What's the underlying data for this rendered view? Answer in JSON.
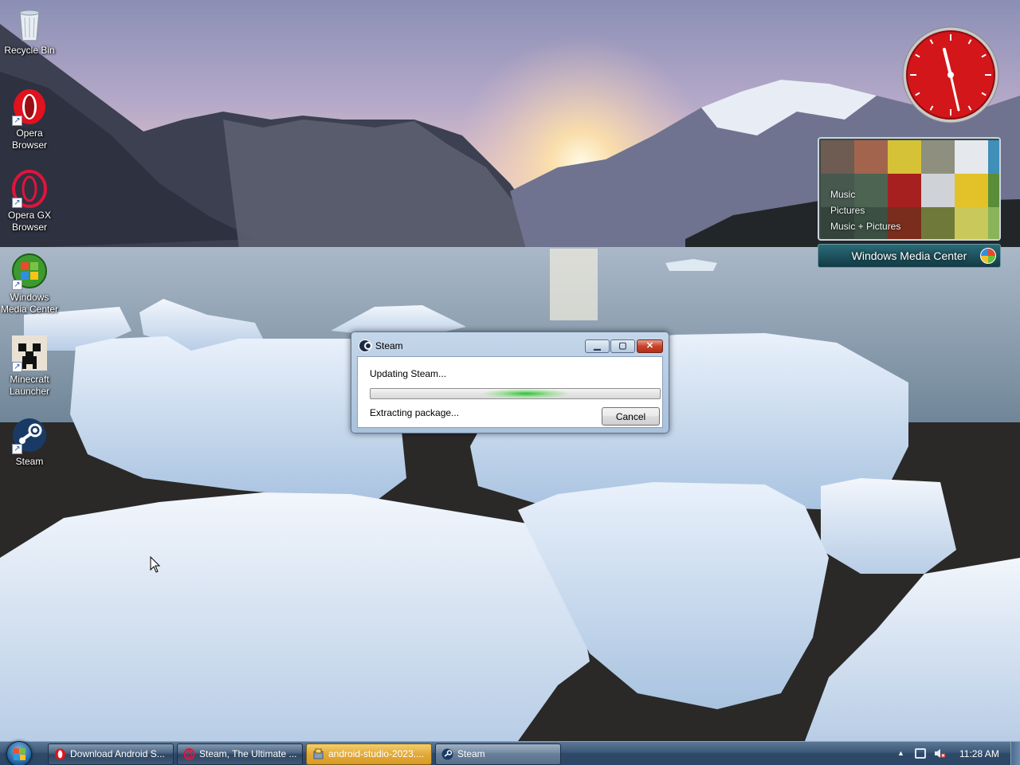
{
  "desktop": {
    "icons": [
      {
        "label": "Recycle Bin",
        "icon": "recycle-bin-icon"
      },
      {
        "label": "Opera Browser",
        "icon": "opera-icon"
      },
      {
        "label": "Opera GX Browser",
        "icon": "opera-gx-icon"
      },
      {
        "label": "Windows Media Center",
        "icon": "windows-media-center-icon"
      },
      {
        "label": "Minecraft Launcher",
        "icon": "minecraft-icon"
      },
      {
        "label": "Steam",
        "icon": "steam-icon"
      }
    ]
  },
  "gadgets": {
    "clock": {
      "time": "11:28",
      "color": "#d2161a"
    },
    "media_center": {
      "menu": [
        "Music",
        "Pictures",
        "Music + Pictures"
      ],
      "title": "Windows Media Center"
    }
  },
  "dialog": {
    "title": "Steam",
    "status": "Updating Steam...",
    "progress_label": "Extracting package...",
    "cancel_label": "Cancel",
    "progress_style": "indeterminate"
  },
  "taskbar": {
    "tasks": [
      {
        "label": "Download Android S...",
        "icon": "opera-icon",
        "state": "normal"
      },
      {
        "label": "Steam, The Ultimate ...",
        "icon": "opera-icon",
        "state": "normal"
      },
      {
        "label": "android-studio-2023....",
        "icon": "installer-icon",
        "state": "flashing"
      },
      {
        "label": "Steam",
        "icon": "steam-icon",
        "state": "active"
      }
    ],
    "clock": "11:28 AM"
  },
  "colors": {
    "taskbar": "#2f4a69",
    "dialog_frame": "#a9c1db",
    "progress_glow": "#29c13b",
    "close_button": "#c8432b"
  }
}
